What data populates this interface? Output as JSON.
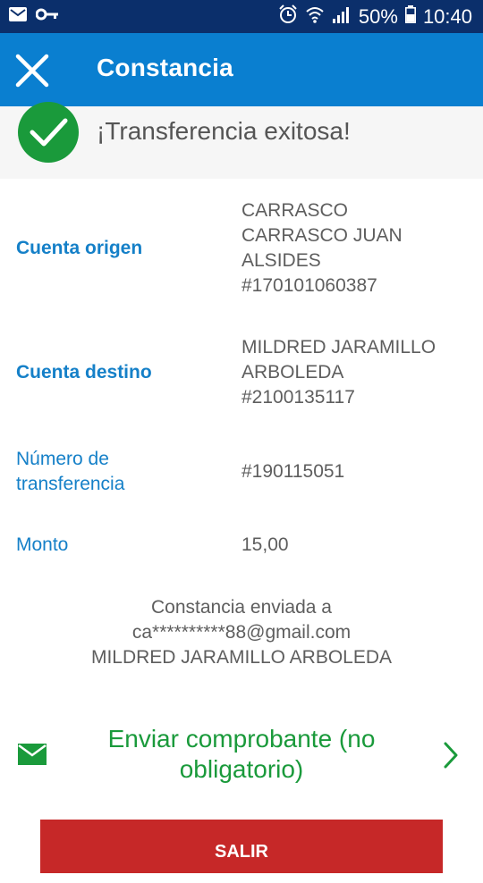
{
  "status_bar": {
    "battery": "50%",
    "time": "10:40",
    "icons": [
      "gmail-icon",
      "key-icon",
      "alarm-icon",
      "wifi-icon",
      "signal-icon",
      "battery-icon"
    ]
  },
  "app_bar": {
    "title": "Constancia",
    "close_icon": "close-icon",
    "color": "#0a7fd0"
  },
  "banner": {
    "message": "¡Transferencia exitosa!",
    "icon": "check-circle-icon",
    "icon_color": "#1a9a3b"
  },
  "details": {
    "origin": {
      "label": "Cuenta origen",
      "lines": [
        "CARRASCO",
        "CARRASCO JUAN",
        "ALSIDES",
        "#170101060387"
      ]
    },
    "destination": {
      "label": "Cuenta destino",
      "lines": [
        "MILDRED JARAMILLO",
        "ARBOLEDA",
        "#2100135117"
      ]
    },
    "transfer_number": {
      "label_lines": [
        "Número de",
        "transferencia"
      ],
      "value": "#190115051"
    },
    "amount": {
      "label": "Monto",
      "value": "15,00"
    }
  },
  "receipt_sent": {
    "lines": [
      "Constancia enviada a",
      "ca**********88@gmail.com",
      "MILDRED JARAMILLO ARBOLEDA"
    ]
  },
  "send_receipt": {
    "label_lines": [
      "Enviar comprobante (no",
      "obligatorio)"
    ],
    "icon": "envelope-icon",
    "chevron": "chevron-right-icon",
    "color": "#1a9a3b"
  },
  "exit_button": {
    "label": "SALIR",
    "color": "#c62828"
  }
}
